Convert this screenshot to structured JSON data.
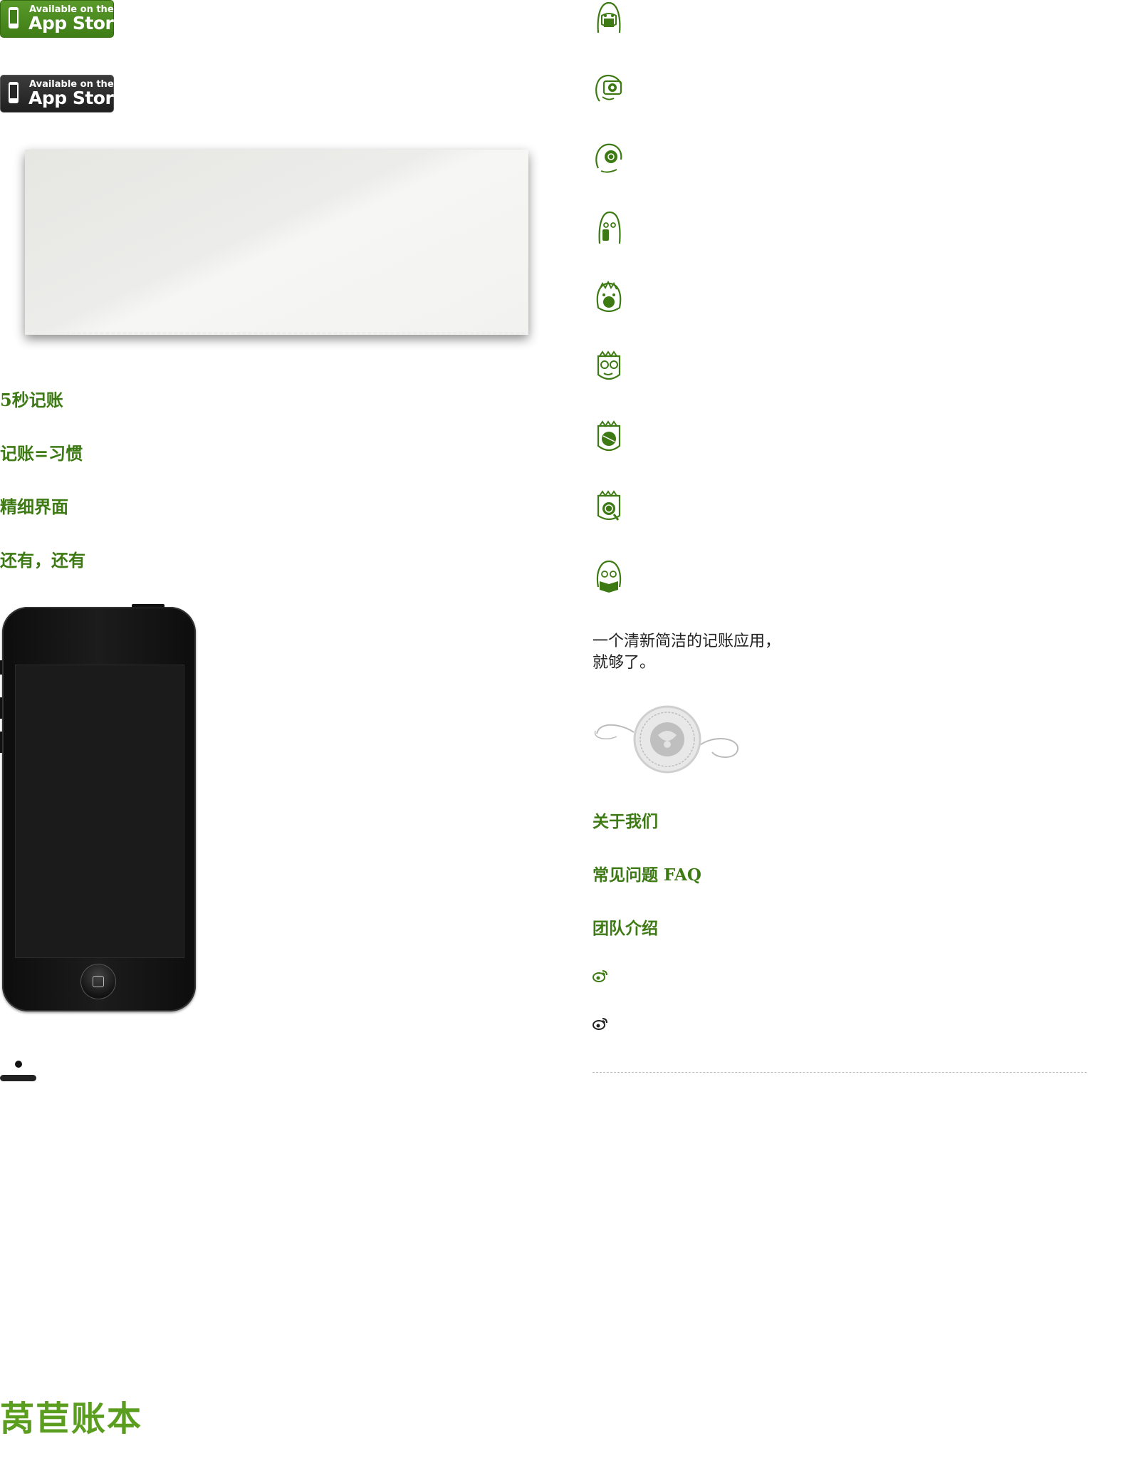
{
  "badges": [
    {
      "small": "Available on the",
      "big": "App Store",
      "color": "#3f7d16"
    },
    {
      "small": "Available on the",
      "big": "App Store",
      "color": "#262626"
    }
  ],
  "features": [
    "5秒记账",
    "记账=习惯",
    "精细界面",
    "还有，还有"
  ],
  "tagline": "一个清新简洁的记账应用，\n就够了。",
  "stamp_label": "stamp-seal",
  "links": [
    "关于我们",
    "常见问题 FAQ",
    "团队介绍"
  ],
  "social": [
    {
      "icon": "weibo-icon",
      "color": "#3d7a14"
    },
    {
      "icon": "weibo-icon",
      "color": "#222222"
    }
  ],
  "avatars": [
    "avatar-girl-mask-icon",
    "avatar-camera-icon",
    "avatar-curly-hair-icon",
    "avatar-girl-phone-icon",
    "avatar-boy-coin-icon",
    "avatar-boy-glasses-icon",
    "avatar-boy-ball-icon",
    "avatar-boy-magnifier-icon",
    "avatar-girl-book-icon"
  ],
  "footer_logo": "莴苣账本",
  "colors": {
    "accent": "#3d7a14",
    "logo": "#5b9e1f"
  }
}
